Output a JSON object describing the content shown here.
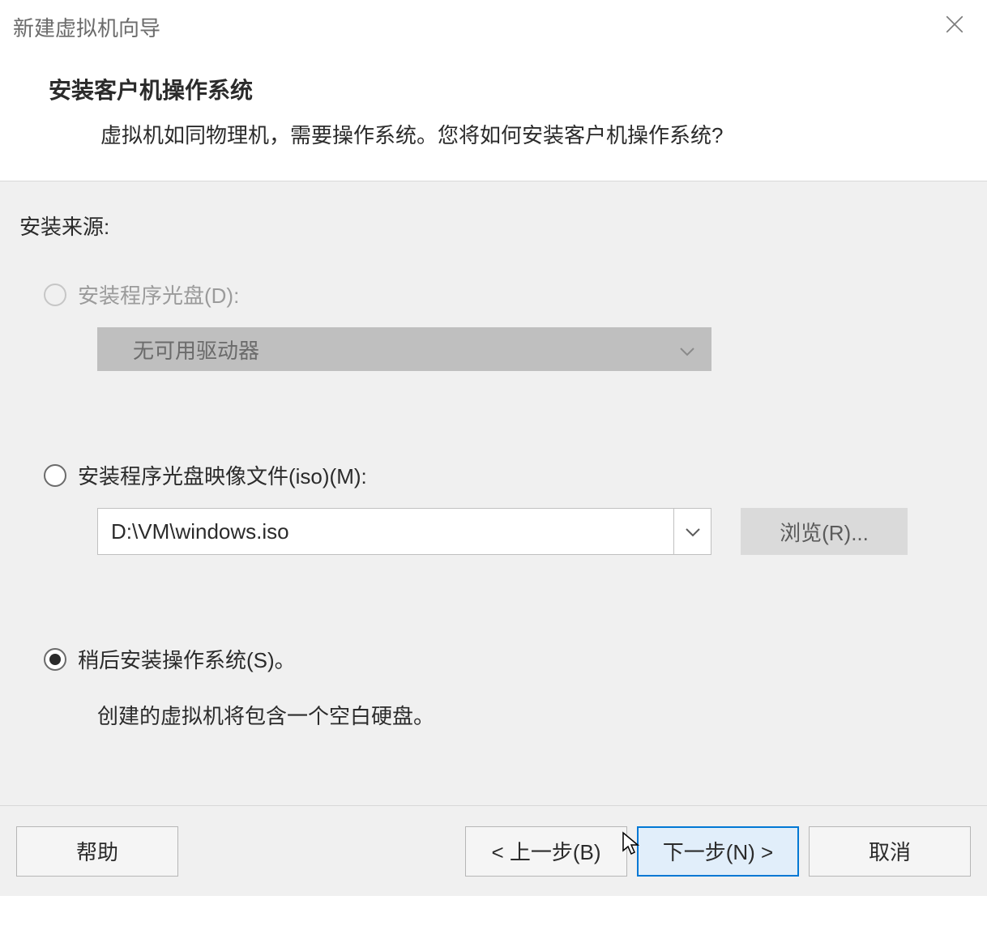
{
  "titlebar": {
    "title": "新建虚拟机向导"
  },
  "header": {
    "title": "安装客户机操作系统",
    "subtitle": "虚拟机如同物理机，需要操作系统。您将如何安装客户机操作系统?"
  },
  "content": {
    "section_label": "安装来源:",
    "option_disc": {
      "label": "安装程序光盘(D):",
      "dropdown_text": "无可用驱动器"
    },
    "option_iso": {
      "label": "安装程序光盘映像文件(iso)(M):",
      "path": "D:\\VM\\windows.iso",
      "browse_label": "浏览(R)..."
    },
    "option_later": {
      "label": "稍后安装操作系统(S)。",
      "note": "创建的虚拟机将包含一个空白硬盘。"
    }
  },
  "footer": {
    "help": "帮助",
    "back": "< 上一步(B)",
    "next": "下一步(N) >",
    "cancel": "取消"
  }
}
